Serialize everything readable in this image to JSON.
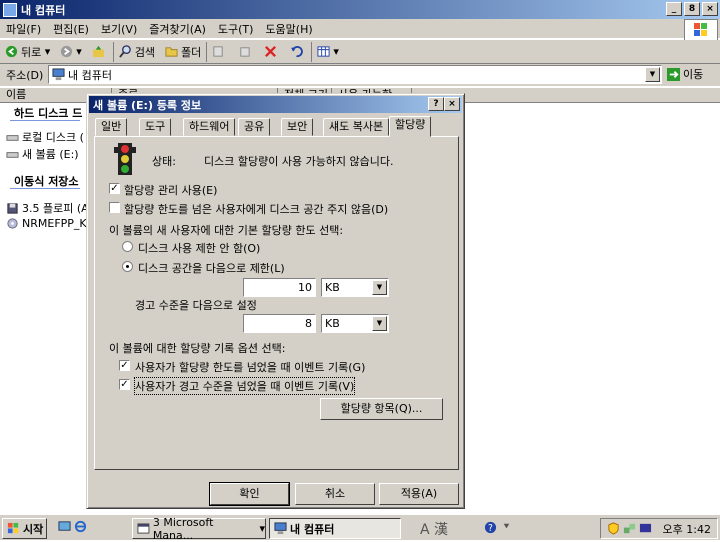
{
  "window": {
    "title": "내 컴퓨터",
    "min": "_",
    "restore": "8",
    "close": "×"
  },
  "menu": [
    "파일(F)",
    "편집(E)",
    "보기(V)",
    "즐겨찾기(A)",
    "도구(T)",
    "도움말(H)"
  ],
  "toolbar": {
    "back": "뒤로",
    "search": "검색",
    "folders": "폴더"
  },
  "address": {
    "label": "주소(D)",
    "value": "내 컴퓨터",
    "go": "이동"
  },
  "columns": [
    "이름",
    "종류",
    "전체 크기",
    "사용 가능한"
  ],
  "explorer": {
    "group_hdd": "하드 디스크 드",
    "hdd_items": [
      "로컬 디스크 (",
      "새 볼륨 (E:)"
    ],
    "group_removable": "이동식 저장소",
    "removable_items": [
      "3.5 플로피 (A",
      "NRMEFPP_K"
    ]
  },
  "dialog": {
    "title": "새 볼륨 (E:) 등록 정보",
    "help": "?",
    "close": "×",
    "tabs": [
      "일반",
      "도구",
      "하드웨어",
      "공유",
      "보안",
      "섀도 복사본",
      "할당량"
    ],
    "status_label": "상태:",
    "status_text": "디스크 할당량이 사용 가능하지 않습니다.",
    "enable_quota": "할당량 관리 사용(E)",
    "deny_space": "할당량 한도를 넘은 사용자에게 디스크 공간 주지 않음(D)",
    "default_limit_heading": "이 볼륨의 새 사용자에 대한 기본 할당량 한도 선택:",
    "no_limit": "디스크 사용 제한 안 함(O)",
    "limit_to": "디스크 공간을 다음으로 제한(L)",
    "limit_value": "10",
    "limit_unit": "KB",
    "warn_label": "경고 수준을 다음으로 설정",
    "warn_value": "8",
    "warn_unit": "KB",
    "log_heading": "이 볼륨에 대한 할당량 기록 옵션 선택:",
    "log_exceed_limit": "사용자가 할당량 한도를 넘었을 때 이벤트 기록(G)",
    "log_exceed_warn": "사용자가 경고 수준을 넘었을 때 이벤트 기록(V)",
    "entries_button": "할당량 항목(Q)...",
    "ok": "확인",
    "cancel": "취소",
    "apply": "적용(A)",
    "check": "✓"
  },
  "taskbar": {
    "start": "시작",
    "task1": "3 Microsoft Mana...",
    "task2": "내 컴퓨터",
    "ime": "A 漢",
    "time": "오후 1:42"
  }
}
